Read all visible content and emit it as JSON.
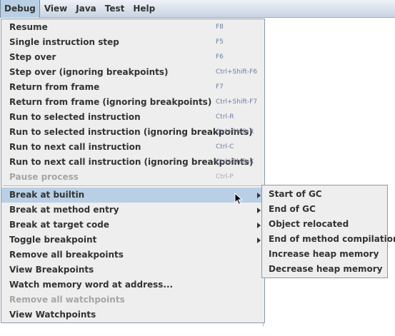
{
  "menubar": {
    "items": [
      {
        "label": "Debug"
      },
      {
        "label": "View"
      },
      {
        "label": "Java"
      },
      {
        "label": "Test"
      },
      {
        "label": "Help"
      }
    ]
  },
  "debug_menu": {
    "items": [
      {
        "label": "Resume",
        "accel": "F8"
      },
      {
        "label": "Single instruction step",
        "accel": "F5"
      },
      {
        "label": "Step over",
        "accel": "F6"
      },
      {
        "label": "Step over (ignoring breakpoints)",
        "accel": "Ctrl+Shift-F6"
      },
      {
        "label": "Return from frame",
        "accel": "F7"
      },
      {
        "label": "Return from frame (ignoring breakpoints)",
        "accel": "Ctrl+Shift-F7"
      },
      {
        "label": "Run to selected instruction",
        "accel": "Ctrl-R"
      },
      {
        "label": "Run to selected instruction (ignoring breakpoints)",
        "accel": "Ctrl+Shift-R"
      },
      {
        "label": "Run to next call instruction",
        "accel": "Ctrl-C"
      },
      {
        "label": "Run to next call instruction (ignoring breakpoints)",
        "accel": "Ctrl+Shift-C"
      },
      {
        "label": "Pause process",
        "accel": "Ctrl-P",
        "disabled": true
      },
      {
        "label": "Break at builtin",
        "submenu": true,
        "highlighted": true
      },
      {
        "label": "Break at method entry",
        "submenu": true
      },
      {
        "label": "Break at target code",
        "submenu": true
      },
      {
        "label": "Toggle breakpoint",
        "submenu": true
      },
      {
        "label": "Remove all breakpoints"
      },
      {
        "label": "View Breakpoints"
      },
      {
        "label": "Watch memory word at address..."
      },
      {
        "label": "Remove all watchpoints",
        "disabled": true
      },
      {
        "label": "View Watchpoints"
      }
    ]
  },
  "break_submenu": {
    "items": [
      {
        "label": "Start of GC"
      },
      {
        "label": "End of GC"
      },
      {
        "label": "Object relocated"
      },
      {
        "label": "End of method compilation"
      },
      {
        "label": "Increase heap memory"
      },
      {
        "label": "Decrease heap memory"
      }
    ]
  },
  "icons": {
    "submenu_arrow": "submenu-arrow-icon",
    "cursor": "mouse-pointer-icon"
  },
  "colors": {
    "highlight": "#b8cfe5",
    "accelerator_text": "#6a7ea3",
    "disabled_text": "#a5a5a5",
    "menu_background": "#eeeeee"
  }
}
